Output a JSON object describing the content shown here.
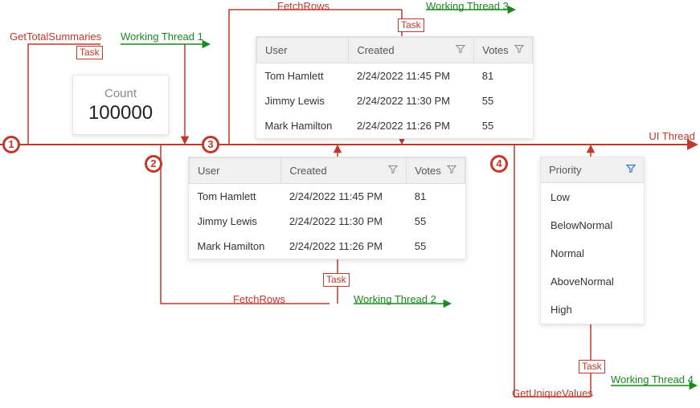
{
  "ui_thread_label": "UI Thread",
  "task_label": "Task",
  "threads": {
    "t1": {
      "op": "GetTotalSummaries",
      "name": "Working Thread 1"
    },
    "t2": {
      "op": "FetchRows",
      "name": "Working Thread 2"
    },
    "t3": {
      "op": "FetchRows",
      "name": "Working Thread 3"
    },
    "t4": {
      "op": "GetUniqueValues",
      "name": "Working Thread 4"
    }
  },
  "markers": {
    "m1": "1",
    "m2": "2",
    "m3": "3",
    "m4": "4"
  },
  "count_card": {
    "label": "Count",
    "value": "100000"
  },
  "columns": {
    "user": "User",
    "created": "Created",
    "votes": "Votes"
  },
  "rows": [
    {
      "user": "Tom Hamlett",
      "created": "2/24/2022 11:45 PM",
      "votes": "81"
    },
    {
      "user": "Jimmy Lewis",
      "created": "2/24/2022 11:30 PM",
      "votes": "55"
    },
    {
      "user": "Mark Hamilton",
      "created": "2/24/2022 11:26 PM",
      "votes": "55"
    }
  ],
  "priority": {
    "header": "Priority",
    "items": [
      "Low",
      "BelowNormal",
      "Normal",
      "AboveNormal",
      "High"
    ]
  },
  "chart_data": {
    "type": "table",
    "description": "Threading diagram: UI Thread timeline spawns four tasks onto working threads, each returns data to UI.",
    "ui_thread": "UI Thread",
    "events": [
      {
        "marker": 1,
        "operation": "GetTotalSummaries",
        "thread": "Working Thread 1",
        "result": {
          "Count": 100000
        }
      },
      {
        "marker": 2,
        "operation": "FetchRows",
        "thread": "Working Thread 2",
        "result_rows": [
          {
            "User": "Tom Hamlett",
            "Created": "2/24/2022 11:45 PM",
            "Votes": 81
          },
          {
            "User": "Jimmy Lewis",
            "Created": "2/24/2022 11:30 PM",
            "Votes": 55
          },
          {
            "User": "Mark Hamilton",
            "Created": "2/24/2022 11:26 PM",
            "Votes": 55
          }
        ]
      },
      {
        "marker": 3,
        "operation": "FetchRows",
        "thread": "Working Thread 3",
        "result_rows": [
          {
            "User": "Tom Hamlett",
            "Created": "2/24/2022 11:45 PM",
            "Votes": 81
          },
          {
            "User": "Jimmy Lewis",
            "Created": "2/24/2022 11:30 PM",
            "Votes": 55
          },
          {
            "User": "Mark Hamilton",
            "Created": "2/24/2022 11:26 PM",
            "Votes": 55
          }
        ]
      },
      {
        "marker": 4,
        "operation": "GetUniqueValues",
        "thread": "Working Thread 4",
        "field": "Priority",
        "result_values": [
          "Low",
          "BelowNormal",
          "Normal",
          "AboveNormal",
          "High"
        ]
      }
    ]
  }
}
